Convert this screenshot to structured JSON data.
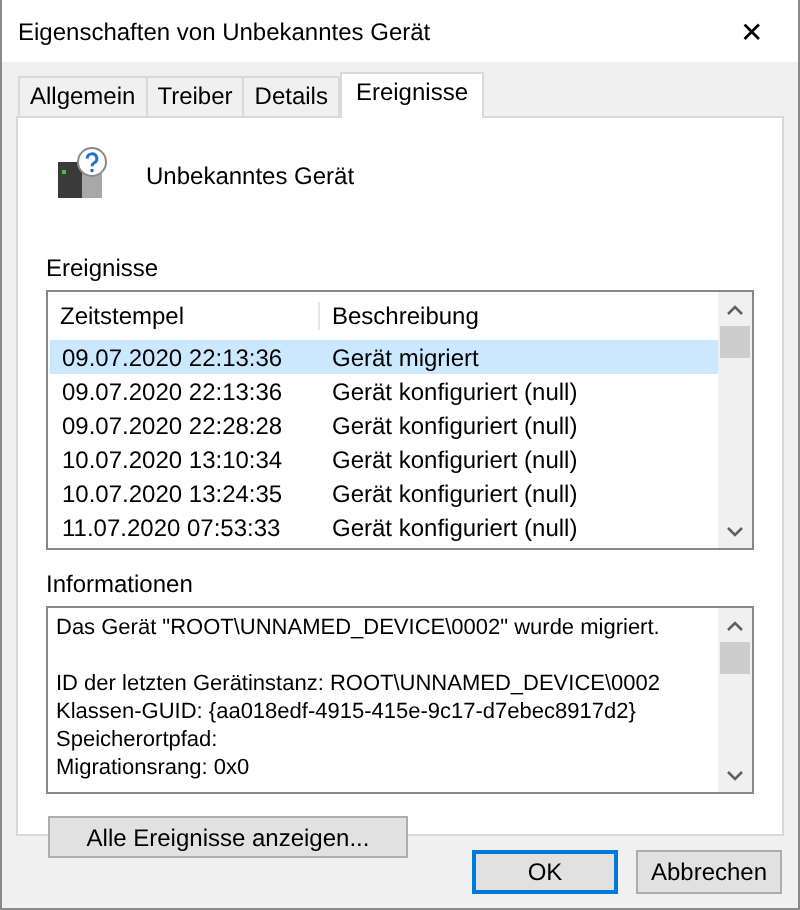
{
  "window": {
    "title": "Eigenschaften von Unbekanntes Gerät",
    "close": "✕"
  },
  "tabs": [
    {
      "label": "Allgemein",
      "selected": false
    },
    {
      "label": "Treiber",
      "selected": false
    },
    {
      "label": "Details",
      "selected": false
    },
    {
      "label": "Ereignisse",
      "selected": true
    }
  ],
  "device": {
    "name": "Unbekanntes Gerät"
  },
  "events": {
    "label": "Ereignisse",
    "columns": [
      "Zeitstempel",
      "Beschreibung"
    ],
    "rows": [
      {
        "cells": [
          "09.07.2020 22:13:36",
          "Gerät migriert"
        ],
        "selected": true
      },
      {
        "cells": [
          "09.07.2020 22:13:36",
          "Gerät konfiguriert (null)"
        ],
        "selected": false
      },
      {
        "cells": [
          "09.07.2020 22:28:28",
          "Gerät konfiguriert (null)"
        ],
        "selected": false
      },
      {
        "cells": [
          "10.07.2020 13:10:34",
          "Gerät konfiguriert (null)"
        ],
        "selected": false
      },
      {
        "cells": [
          "10.07.2020 13:24:35",
          "Gerät konfiguriert (null)"
        ],
        "selected": false
      },
      {
        "cells": [
          "11.07.2020 07:53:33",
          "Gerät konfiguriert (null)"
        ],
        "selected": false
      }
    ]
  },
  "information": {
    "label": "Informationen",
    "paragraphs": [
      [
        "Das Gerät \"ROOT\\UNNAMED_DEVICE\\0002\" wurde migriert."
      ],
      [
        "ID der letzten Gerätinstanz: ROOT\\UNNAMED_DEVICE\\0002",
        "Klassen-GUID: {aa018edf-4915-415e-9c17-d7ebec8917d2}",
        "Speicherortpfad:",
        "Migrationsrang: 0x0"
      ]
    ]
  },
  "show_all_button": "Alle Ereignisse anzeigen...",
  "buttons": [
    {
      "label": "OK",
      "default": true
    },
    {
      "label": "Abbrechen",
      "default": false
    }
  ]
}
